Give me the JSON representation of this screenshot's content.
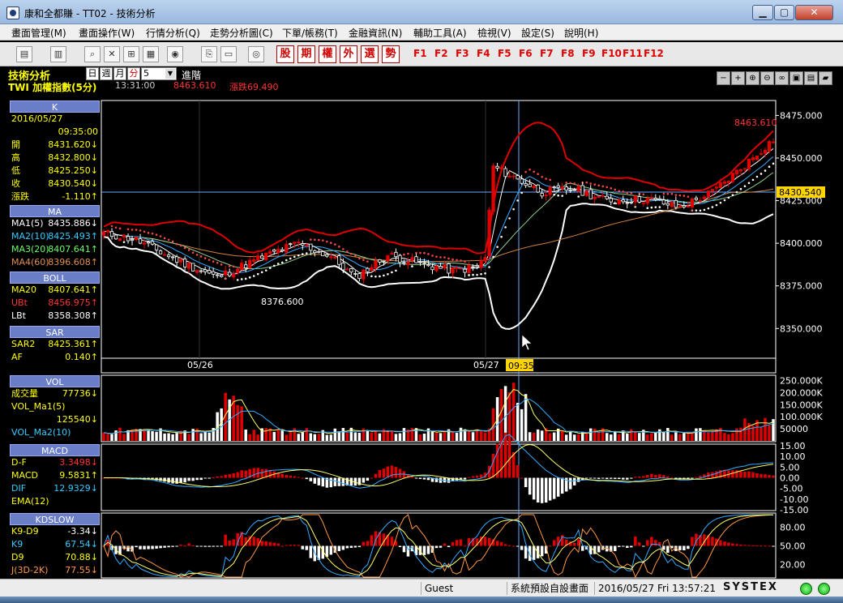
{
  "window": {
    "title": "康和全都賺 - TT02 - 技術分析",
    "min": "▁",
    "max": "▢",
    "close": "✕"
  },
  "menu": [
    "畫面管理(M)",
    "畫面操作(W)",
    "行情分析(Q)",
    "走勢分析圖(C)",
    "下單/帳務(T)",
    "金融資訊(N)",
    "輔助工具(A)",
    "檢視(V)",
    "設定(S)",
    "說明(H)"
  ],
  "toolbar": {
    "red_buttons": [
      "股",
      "期",
      "權",
      "外",
      "選",
      "勢"
    ],
    "function_keys": [
      "F1",
      "F2",
      "F3",
      "F4",
      "F5",
      "F6",
      "F7",
      "F8",
      "F9",
      "F10",
      "F11",
      "F12"
    ]
  },
  "header": {
    "panel_title": "技術分析",
    "periods": [
      "日",
      "週",
      "月",
      "分"
    ],
    "active_period": "分",
    "select_value": "5",
    "advanced": "進階",
    "symbol": "TWI  加權指數(5分)",
    "time": "13:31:00",
    "price": "8463.610",
    "change": "漲跌69.490"
  },
  "panels": {
    "k": {
      "title": "K",
      "date": "2016/05/27",
      "time": "09:35:00",
      "rows": [
        {
          "label": "開",
          "value": "8431.620↓"
        },
        {
          "label": "高",
          "value": "8432.800↓"
        },
        {
          "label": "低",
          "value": "8425.250↓"
        },
        {
          "label": "收",
          "value": "8430.540↓"
        },
        {
          "label": "漲跌",
          "value": "-1.110↑"
        }
      ]
    },
    "ma": {
      "title": "MA",
      "rows": [
        {
          "label": "MA1(5)",
          "value": "8435.886↓"
        },
        {
          "label": "MA2(10)",
          "value": "8425.493↑"
        },
        {
          "label": "MA3(20)",
          "value": "8407.641↑"
        },
        {
          "label": "MA4(60)",
          "value": "8396.608↑"
        }
      ]
    },
    "boll": {
      "title": "BOLL",
      "rows": [
        {
          "label": "MA20",
          "value": "8407.641↑"
        },
        {
          "label": "UBt",
          "value": "8456.975↑"
        },
        {
          "label": "LBt",
          "value": "8358.308↑"
        }
      ]
    },
    "sar": {
      "title": "SAR",
      "rows": [
        {
          "label": "SAR2",
          "value": "8425.361↑"
        },
        {
          "label": "AF",
          "value": "0.140↑"
        }
      ]
    },
    "vol": {
      "title": "VOL",
      "rows": [
        {
          "label": "成交量",
          "value": "77736↓"
        },
        {
          "label": "VOL_Ma1(5)",
          "value": ""
        },
        {
          "label": "",
          "value": "125540↓"
        },
        {
          "label": "VOL_Ma2(10)",
          "value": ""
        }
      ]
    },
    "macd": {
      "title": "MACD",
      "rows": [
        {
          "label": "D-F",
          "value": "3.3498↓"
        },
        {
          "label": "MACD",
          "value": "9.5831↑"
        },
        {
          "label": "DIF",
          "value": "12.9329↓"
        },
        {
          "label": "EMA(12)",
          "value": ""
        }
      ]
    },
    "kd": {
      "title": "KDSLOW",
      "rows": [
        {
          "label": "K9-D9",
          "value": "-3.34↓"
        },
        {
          "label": "K9",
          "value": "67.54↓"
        },
        {
          "label": "D9",
          "value": "70.88↓"
        },
        {
          "label": "J(3D-2K)",
          "value": "77.55↓"
        }
      ]
    }
  },
  "chart_data": {
    "type": "line",
    "price_axis": {
      "ticks": [
        "8475.000",
        "8450.000",
        "8425.000",
        "8400.000",
        "8375.000",
        "8350.000"
      ],
      "ylim": [
        8343,
        8479
      ],
      "cursor_label": "8430.540"
    },
    "x_labels": [
      "05/26",
      "05/27"
    ],
    "cursor_time": "09:35",
    "annotations": [
      {
        "text": "8376.600",
        "value": 8376.6
      },
      {
        "text": "8463.610",
        "value": 8463.61
      }
    ],
    "vol_axis": [
      "250.000K",
      "200.000K",
      "150.000K",
      "100.000K",
      "50000"
    ],
    "macd_axis": [
      "15.00",
      "10.00",
      "5.00",
      "0.00",
      "-5.00",
      "-10.00",
      "-15.00"
    ],
    "kd_axis": [
      "80.00",
      "50.00",
      "20.00"
    ],
    "colors": {
      "up": "#e00000",
      "down": "#ffffff",
      "boll": "#e00000",
      "lower": "#ffffff",
      "ma20": "#8fd08f",
      "ma60": "#d08040"
    }
  },
  "status": {
    "user": "Guest",
    "screen": "系統預設自設畫面",
    "datetime": "2016/05/27 Fri 13:57:21",
    "brand": "SYSTEX"
  }
}
